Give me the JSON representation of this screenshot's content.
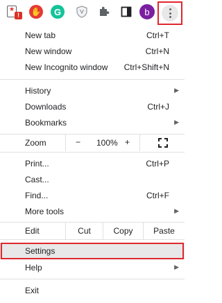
{
  "toolbar": {
    "extensions": [
      {
        "icon": "bookmark-star-icon",
        "badge": "!"
      },
      {
        "icon": "red-extension-icon",
        "glyph": "✋"
      },
      {
        "icon": "grammarly-icon",
        "glyph": "G"
      },
      {
        "icon": "shield-icon"
      },
      {
        "icon": "puzzle-icon"
      },
      {
        "icon": "side-panel-icon"
      }
    ],
    "profile_initial": "b",
    "menu_icon": "three-dots-vertical-icon",
    "highlight_color": "#e0262d"
  },
  "menu": {
    "new_tab": {
      "label": "New tab",
      "shortcut": "Ctrl+T"
    },
    "new_window": {
      "label": "New window",
      "shortcut": "Ctrl+N"
    },
    "new_incognito": {
      "label": "New Incognito window",
      "shortcut": "Ctrl+Shift+N"
    },
    "history": {
      "label": "History"
    },
    "downloads": {
      "label": "Downloads",
      "shortcut": "Ctrl+J"
    },
    "bookmarks": {
      "label": "Bookmarks"
    },
    "zoom": {
      "label": "Zoom",
      "minus": "−",
      "value": "100%",
      "plus": "+"
    },
    "print": {
      "label": "Print...",
      "shortcut": "Ctrl+P"
    },
    "cast": {
      "label": "Cast..."
    },
    "find": {
      "label": "Find...",
      "shortcut": "Ctrl+F"
    },
    "more_tools": {
      "label": "More tools"
    },
    "edit": {
      "label": "Edit",
      "cut": "Cut",
      "copy": "Copy",
      "paste": "Paste"
    },
    "settings": {
      "label": "Settings"
    },
    "help": {
      "label": "Help"
    },
    "exit": {
      "label": "Exit"
    }
  }
}
